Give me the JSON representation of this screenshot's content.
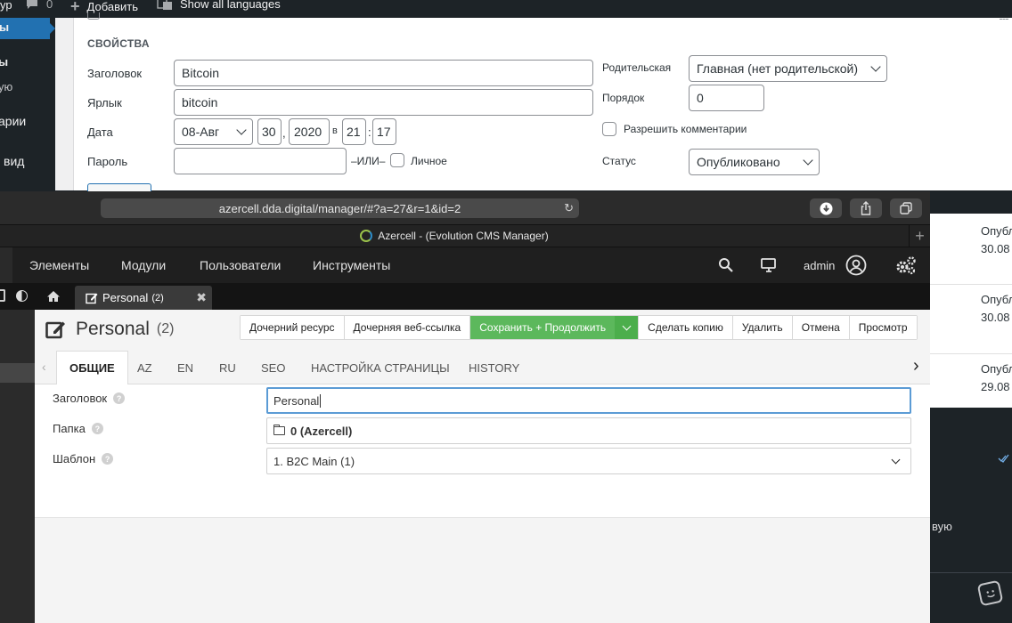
{
  "wp": {
    "adminbar": {
      "site_fragment": "ур",
      "comments_count": "0",
      "add_label": "Добавить",
      "languages_label": "Show all languages"
    },
    "sidebar": {
      "items": [
        "ы",
        "ы",
        "ую",
        "арии",
        "вид"
      ]
    },
    "props": {
      "heading": "СВОЙСТВА",
      "title_label": "Заголовок",
      "title_value": "Bitcoin",
      "slug_label": "Ярлык",
      "slug_value": "bitcoin",
      "date_label": "Дата",
      "date_month": "08-Авг",
      "date_day": "30",
      "date_year": "2020",
      "date_at": "в",
      "date_hour": "21",
      "date_min": "17",
      "password_label": "Пароль",
      "or_label": "–ИЛИ–",
      "private_label": "Личное",
      "parent_label": "Родительская",
      "parent_value": "Главная (нет родительской)",
      "order_label": "Порядок",
      "order_value": "0",
      "comments_label": "Разрешить комментарии",
      "status_label": "Статус",
      "status_value": "Опубликовано"
    },
    "right_list": [
      {
        "status": "Опубл",
        "date": "30.08"
      },
      {
        "status": "Опубл",
        "date": "30.08"
      },
      {
        "status": "Опубл",
        "date": "29.08"
      }
    ],
    "right_bottom_text": "вую"
  },
  "safari": {
    "url": "azercell.dda.digital/manager/#?a=27&r=1&id=2",
    "tab_title": "Azercell - (Evolution CMS Manager)"
  },
  "cms": {
    "nav": {
      "elements": "Элементы",
      "modules": "Модули",
      "users": "Пользователи",
      "tools": "Инструменты",
      "user": "admin"
    },
    "doc_tab": {
      "label": "Personal",
      "count": "(2)"
    },
    "page": {
      "title": "Personal",
      "count": "(2)"
    },
    "actions": {
      "child_resource": "Дочерний ресурс",
      "child_weblink": "Дочерняя веб-ссылка",
      "save_continue": "Сохранить + Продолжить",
      "duplicate": "Сделать копию",
      "delete": "Удалить",
      "cancel": "Отмена",
      "view": "Просмотр"
    },
    "tabs": [
      "ОБЩИЕ",
      "AZ",
      "EN",
      "RU",
      "SEO",
      "НАСТРОЙКА СТРАНИЦЫ",
      "HISTORY"
    ],
    "form": {
      "title_label": "Заголовок",
      "title_value": "Personal",
      "folder_label": "Папка",
      "folder_value": "0 (Azercell)",
      "template_label": "Шаблон",
      "template_value": "1. B2C Main (1)"
    }
  },
  "colors": {
    "wp_blue": "#2271b1",
    "cms_green": "#5cb85c",
    "focus_blue": "#5b9bd5"
  }
}
